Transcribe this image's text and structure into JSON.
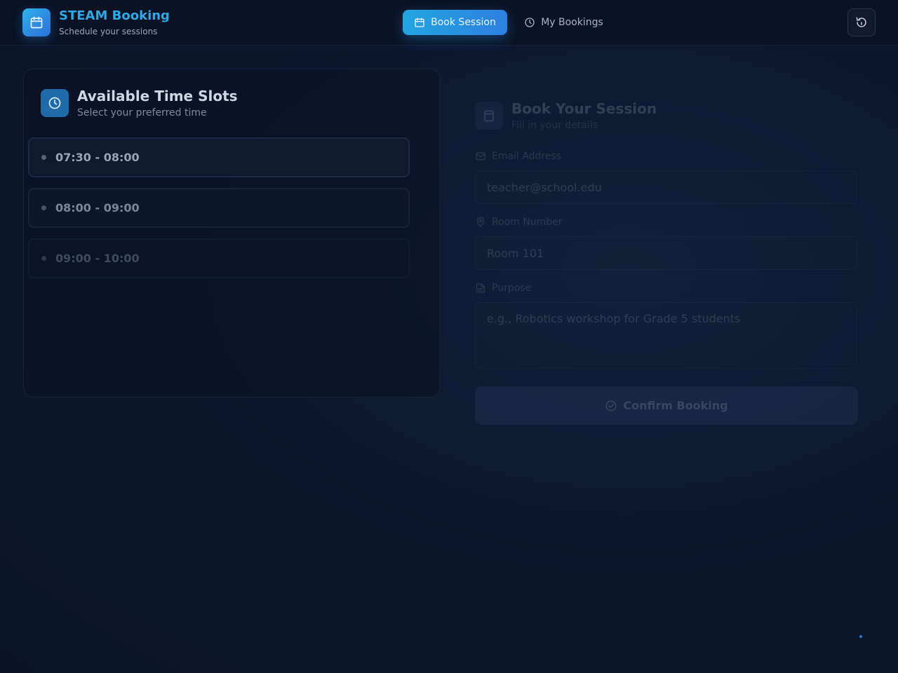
{
  "header": {
    "title": "STEAM Booking",
    "subtitle": "Schedule your sessions",
    "logo_icon": "calendar-icon",
    "tabs": [
      {
        "label": "Book Session",
        "icon": "calendar-icon",
        "active": true
      },
      {
        "label": "My Bookings",
        "icon": "clock-icon",
        "active": false
      }
    ],
    "refresh_icon": "refresh-icon"
  },
  "slots_panel": {
    "title": "Available Time Slots",
    "subtitle": "Select your preferred time",
    "icon": "clock-icon",
    "slots": [
      {
        "time": "07:30 - 08:00"
      },
      {
        "time": "08:00 - 09:00"
      },
      {
        "time": "09:00 - 10:00"
      }
    ]
  },
  "form": {
    "title": "Book Your Session",
    "subtitle": "Fill in your details",
    "icon": "calendar-icon",
    "email_label": "Email Address",
    "email_placeholder": "teacher@school.edu",
    "room_label": "Room Number",
    "room_placeholder": "Room 101",
    "purpose_label": "Purpose",
    "purpose_placeholder": "e.g., Robotics workshop for Grade 5 students",
    "submit_label": "Confirm Booking"
  },
  "colors": {
    "accent": "#2ea8e6",
    "background": "#0d1830"
  }
}
